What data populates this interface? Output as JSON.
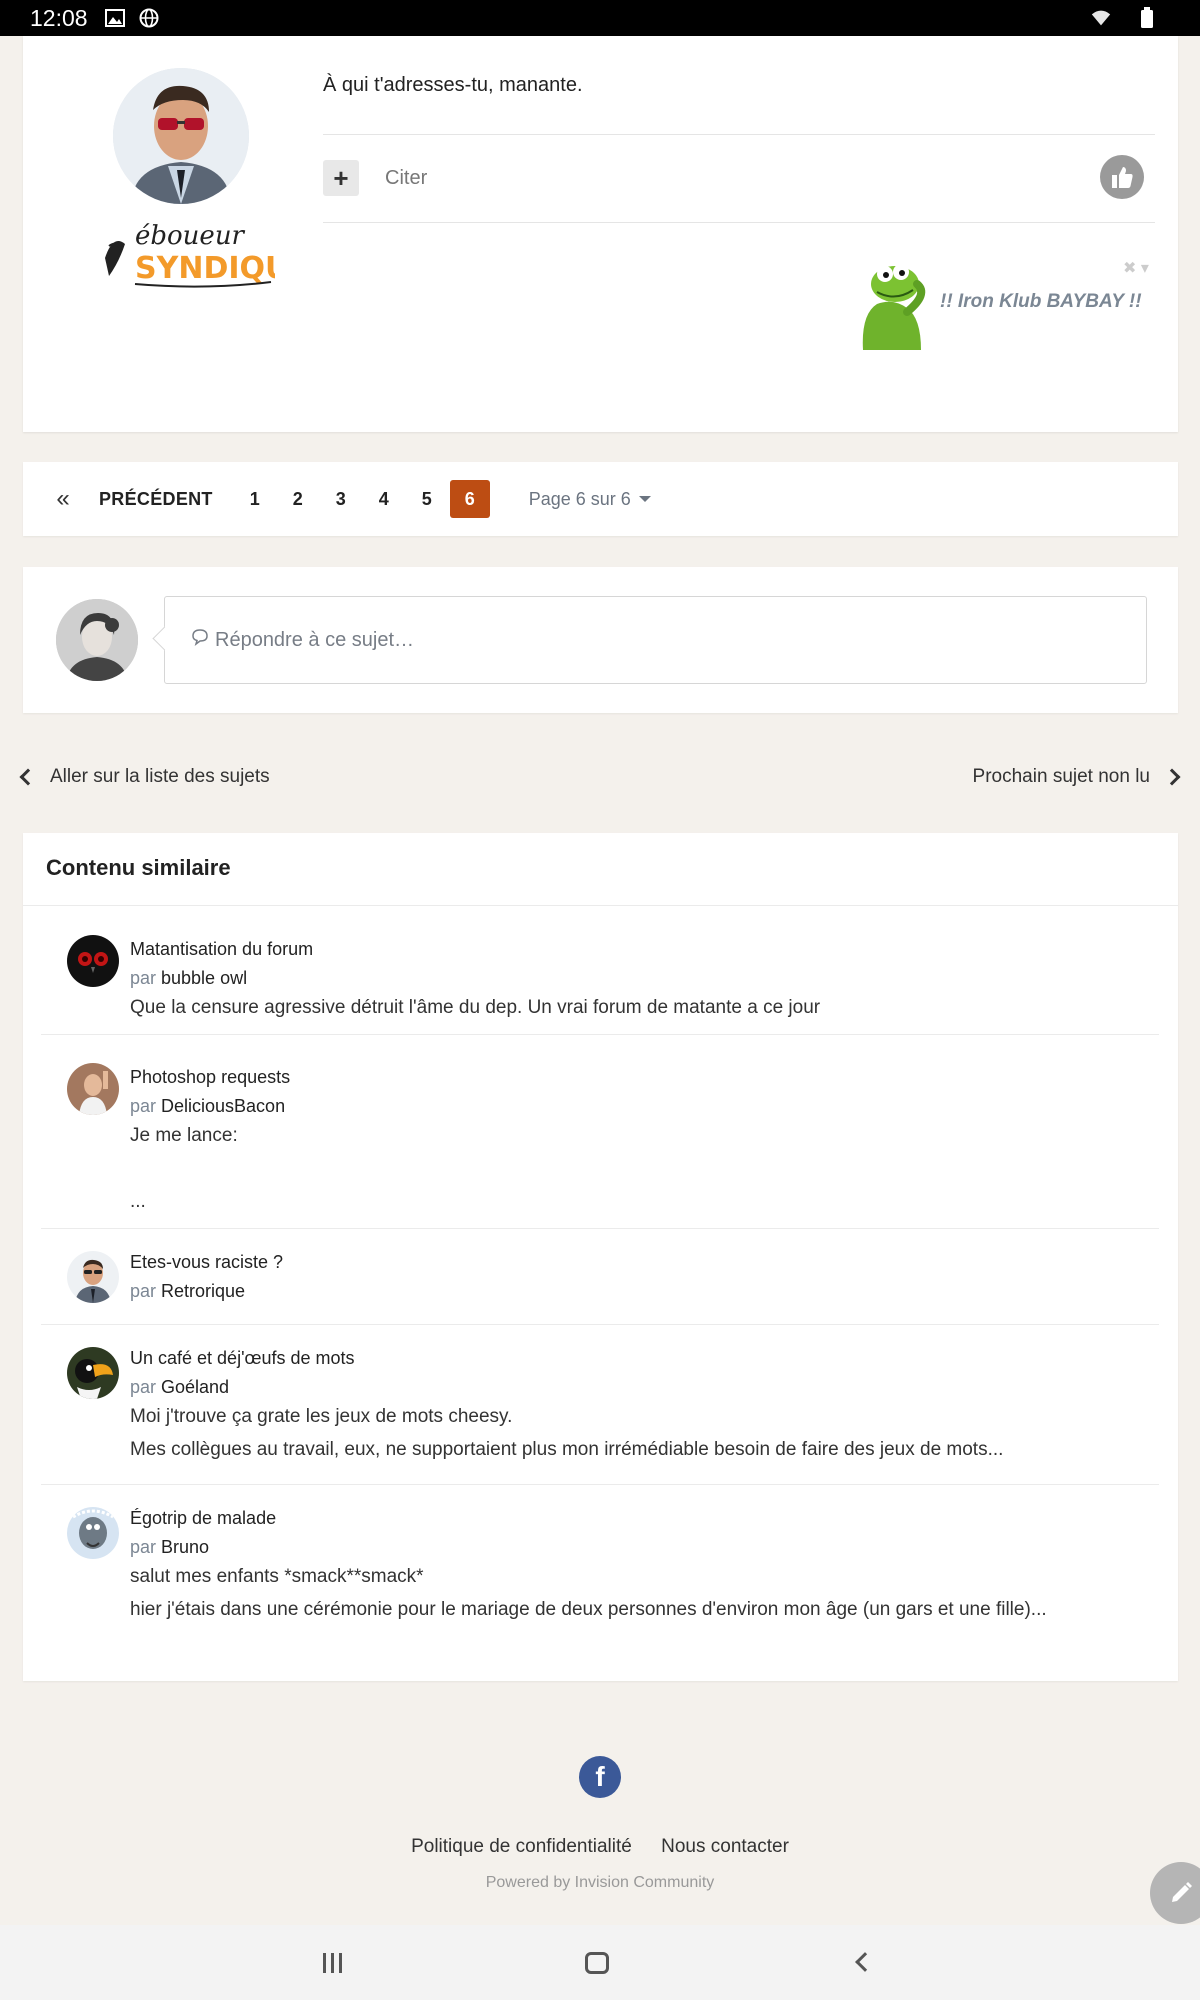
{
  "status_bar": {
    "time": "12:08"
  },
  "post": {
    "text": "À qui t'adresses-tu, manante.",
    "quote_label": "Citer",
    "signature_text": "!! Iron Klub BAYBAY !!",
    "signature_logo_text": "éboueur SYNDIQUÉ"
  },
  "pagination": {
    "previous_label": "PRÉCÉDENT",
    "pages": [
      "1",
      "2",
      "3",
      "4",
      "5",
      "6"
    ],
    "current_page": "6",
    "jump_label": "Page 6 sur 6"
  },
  "reply": {
    "placeholder": "Répondre à ce sujet…"
  },
  "topic_nav": {
    "back_label": "Aller sur la liste des sujets",
    "next_label": "Prochain sujet non lu"
  },
  "similar": {
    "title": "Contenu similaire",
    "by_label": "par",
    "items": [
      {
        "title": "Matantisation du forum",
        "author": "bubble owl",
        "lines": [
          "Que la censure agressive détruit l'âme du dep. Un vrai forum de matante a ce jour"
        ]
      },
      {
        "title": "Photoshop requests",
        "author": "DeliciousBacon",
        "lines": [
          "Je me lance:",
          "..."
        ]
      },
      {
        "title": "Etes-vous raciste ?",
        "author": "Retrorique",
        "lines": []
      },
      {
        "title": "Un café et déj'œufs de mots",
        "author": "Goéland",
        "lines": [
          "Moi j'trouve ça grate les jeux de mots cheesy.",
          "Mes collègues au travail, eux, ne supportaient plus mon irrémédiable besoin de faire des jeux de mots..."
        ]
      },
      {
        "title": "Égotrip de malade",
        "author": "Bruno",
        "lines": [
          "salut mes enfants *smack**smack*",
          "hier j'étais dans une cérémonie pour le mariage de deux personnes d'environ mon âge (un gars et une fille)..."
        ]
      }
    ]
  },
  "footer": {
    "privacy_label": "Politique de confidentialité",
    "contact_label": "Nous contacter",
    "powered_label": "Powered by Invision Community"
  },
  "colors": {
    "accent": "#bd4d13",
    "facebook": "#3b5998"
  }
}
